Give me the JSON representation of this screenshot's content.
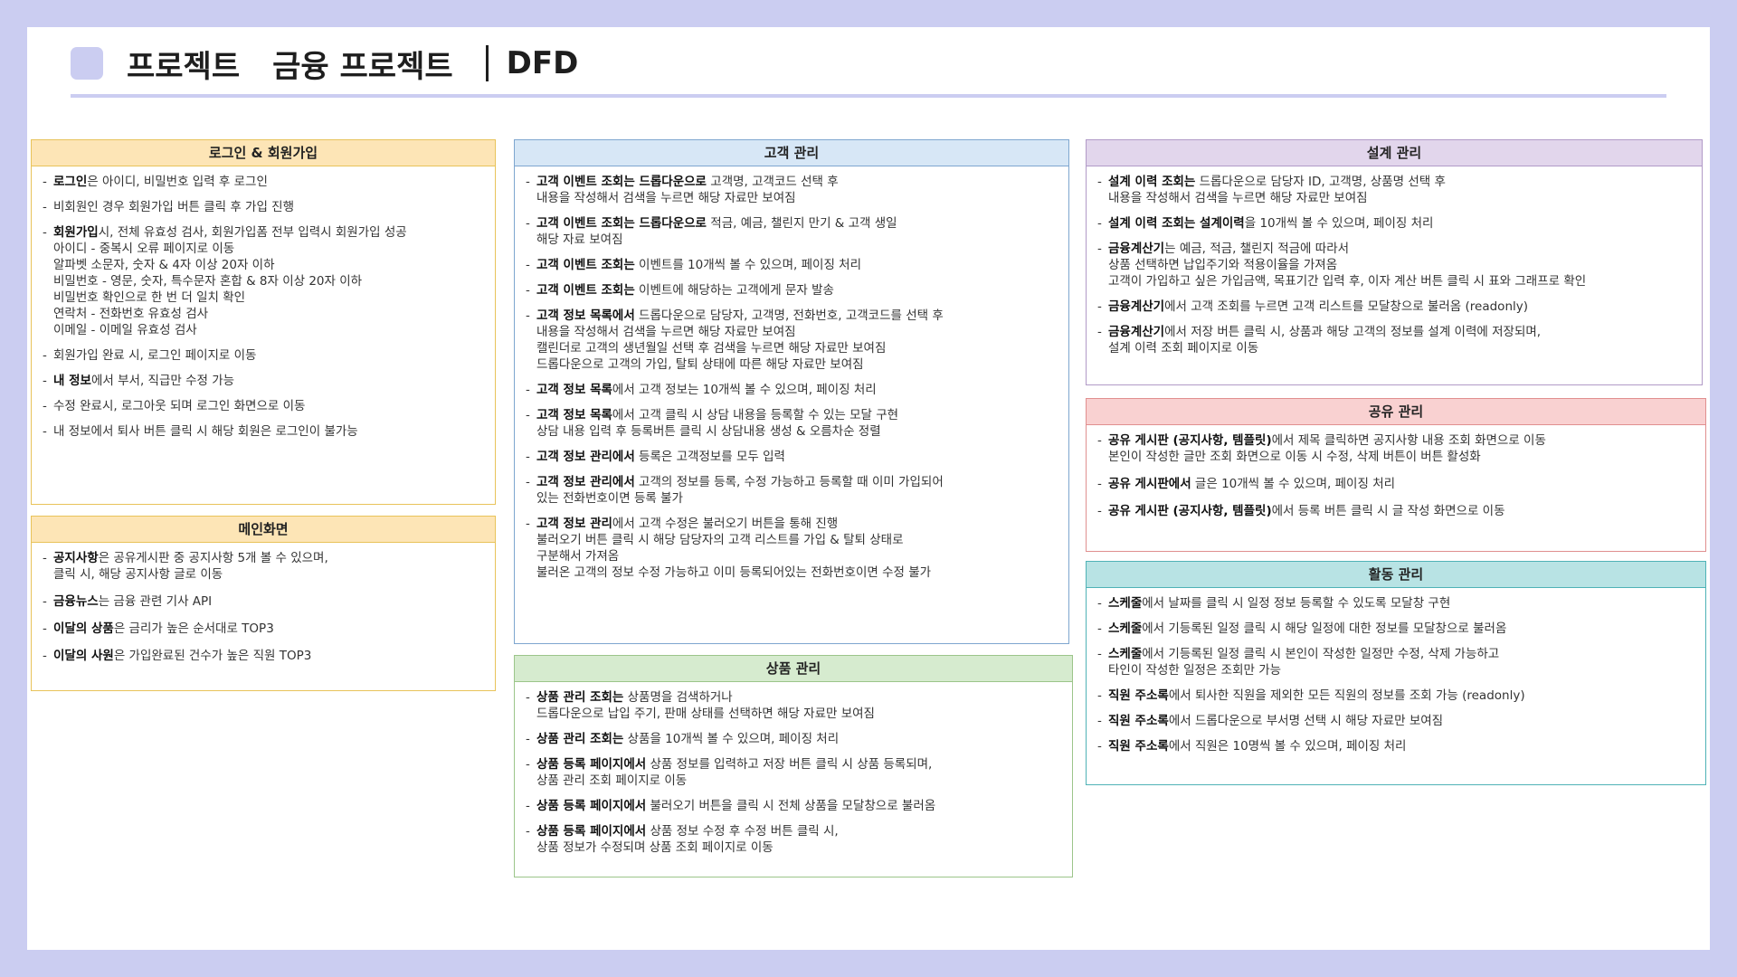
{
  "header": {
    "word1": "프로젝트",
    "word2": "금융 프로젝트",
    "word3": "DFD"
  },
  "panels": {
    "login": {
      "title": "로그인 & 회원가입",
      "items": [
        {
          "b": "로그인",
          "t": "은 아이디, 비밀번호 입력 후 로그인"
        },
        {
          "b": "",
          "t": "비회원인 경우 회원가입 버튼 클릭 후 가입 진행"
        },
        {
          "b": "회원가입",
          "t": "시, 전체 유효성 검사, 회원가입폼 전부 입력시 회원가입 성공\n아이디 - 중복시 오류 페이지로 이동\n        알파벳 소문자, 숫자 & 4자 이상 20자 이하\n비밀번호 - 영문, 숫자, 특수문자 혼합 & 8자 이상 20자 이하\n           비밀번호 확인으로 한 번 더 일치 확인\n연락처 - 전화번호 유효성 검사\n이메일 - 이메일 유효성 검사"
        },
        {
          "b": "",
          "t": "회원가입 완료 시, 로그인 페이지로 이동"
        },
        {
          "b": "내 정보",
          "t": "에서 부서, 직급만 수정 가능"
        },
        {
          "b": "",
          "t": "수정 완료시, 로그아웃 되며 로그인 화면으로 이동"
        },
        {
          "b": "",
          "t": "내 정보에서 퇴사 버튼 클릭 시 해당 회원은 로그인이 불가능"
        }
      ]
    },
    "main": {
      "title": "메인화면",
      "items": [
        {
          "b": "공지사항",
          "t": "은 공유게시판 중 공지사항 5개 볼 수 있으며,\n클릭 시, 해당 공지사항 글로 이동"
        },
        {
          "b": "금융뉴스",
          "t": "는 금융 관련 기사 API"
        },
        {
          "b": "이달의 상품",
          "t": "은 금리가 높은 순서대로 TOP3"
        },
        {
          "b": "이달의 사원",
          "t": "은 가입완료된 건수가 높은 직원 TOP3"
        }
      ]
    },
    "customer": {
      "title": "고객 관리",
      "items": [
        {
          "b": "고객 이벤트 조회는 드롭다운으로",
          "t": " 고객명, 고객코드 선택 후\n내용을 작성해서 검색을 누르면 해당 자료만 보여짐"
        },
        {
          "b": "고객 이벤트 조회는 드롭다운으로",
          "t": " 적금, 예금, 챌린지 만기 & 고객 생일\n해당 자료 보여짐"
        },
        {
          "b": "고객 이벤트 조회는",
          "t": " 이벤트를 10개씩 볼 수 있으며, 페이징 처리"
        },
        {
          "b": "고객 이벤트 조회는",
          "t": " 이벤트에 해당하는 고객에게 문자 발송"
        },
        {
          "b": "고객 정보 목록에서",
          "t": " 드롭다운으로 담당자, 고객명, 전화번호, 고객코드를 선택 후\n내용을 작성해서 검색을 누르면 해당 자료만 보여짐\n캘린더로 고객의 생년월일 선택 후 검색을 누르면 해당 자료만 보여짐\n드롭다운으로 고객의 가입, 탈퇴 상태에 따른 해당 자료만 보여짐"
        },
        {
          "b": "고객 정보 목록",
          "t": "에서 고객 정보는 10개씩 볼 수 있으며, 페이징 처리"
        },
        {
          "b": "고객 정보 목록",
          "t": "에서 고객 클릭 시 상담 내용을 등록할 수 있는 모달 구현\n상담 내용 입력 후 등록버튼 클릭 시 상담내용 생성 & 오름차순 정렬"
        },
        {
          "b": "고객 정보 관리에서",
          "t": " 등록은 고객정보를 모두 입력"
        },
        {
          "b": "고객 정보 관리에서",
          "t": " 고객의 정보를 등록, 수정 가능하고 등록할 때 이미 가입되어\n있는 전화번호이면 등록 불가"
        },
        {
          "b": "고객 정보 관리",
          "t": "에서 고객 수정은 불러오기 버튼을 통해 진행\n불러오기 버튼 클릭 시 해당 담당자의 고객 리스트를 가입 & 탈퇴 상태로\n구분해서 가져옴\n불러온 고객의 정보 수정 가능하고 이미 등록되어있는 전화번호이면 수정 불가"
        }
      ]
    },
    "product": {
      "title": "상품 관리",
      "items": [
        {
          "b": "상품 관리 조회는",
          "t": " 상품명을 검색하거나\n드롭다운으로 납입 주기, 판매 상태를 선택하면 해당 자료만 보여짐"
        },
        {
          "b": "상품 관리 조회는",
          "t": " 상품을 10개씩 볼 수 있으며, 페이징 처리"
        },
        {
          "b": "상품 등록 페이지에서",
          "t": " 상품 정보를 입력하고 저장 버튼 클릭 시 상품 등록되며,\n상품 관리 조회 페이지로 이동"
        },
        {
          "b": "상품 등록 페이지에서",
          "t": " 불러오기 버튼을 클릭 시 전체 상품을 모달창으로 불러옴"
        },
        {
          "b": "상품 등록 페이지에서",
          "t": " 상품 정보 수정 후 수정 버튼 클릭 시,\n상품 정보가 수정되며 상품 조회 페이지로 이동"
        }
      ]
    },
    "design": {
      "title": "설계 관리",
      "items": [
        {
          "b": "설계 이력 조회는",
          "t": " 드롭다운으로 담당자 ID, 고객명, 상품명 선택 후\n내용을 작성해서 검색을 누르면 해당 자료만 보여짐"
        },
        {
          "b": "설계 이력 조회는 설계이력",
          "t": "을 10개씩 볼 수 있으며, 페이징 처리"
        },
        {
          "b": "금융계산기",
          "t": "는 예금, 적금, 챌린지 적금에 따라서\n상품 선택하면 납입주기와 적용이율을 가져옴\n고객이 가입하고 싶은 가입금액, 목표기간 입력 후, 이자 계산 버튼 클릭 시 표와 그래프로 확인"
        },
        {
          "b": "금융계산기",
          "t": "에서 고객 조회를 누르면 고객 리스트를 모달창으로 불러옴 (readonly)"
        },
        {
          "b": "금융계산기",
          "t": "에서 저장 버튼 클릭 시, 상품과 해당 고객의 정보를 설계 이력에 저장되며,\n설계 이력 조회 페이지로 이동"
        }
      ]
    },
    "share": {
      "title": "공유 관리",
      "items": [
        {
          "b": "공유 게시판 (공지사항, 템플릿)",
          "t": "에서 제목 클릭하면 공지사항 내용 조회 화면으로 이동\n본인이 작성한 글만 조회 화면으로 이동 시 수정, 삭제 버튼이 버튼 활성화"
        },
        {
          "b": "공유 게시판에서",
          "t": " 글은 10개씩 볼 수 있으며, 페이징 처리"
        },
        {
          "b": "공유 게시판 (공지사항, 템플릿)",
          "t": "에서 등록 버튼 클릭 시 글 작성 화면으로 이동"
        }
      ]
    },
    "activity": {
      "title": "활동 관리",
      "items": [
        {
          "b": "스케줄",
          "t": "에서 날짜를 클릭 시 일정 정보 등록할 수 있도록 모달창 구현"
        },
        {
          "b": "스케줄",
          "t": "에서 기등록된 일정 클릭 시 해당 일정에 대한 정보를 모달창으로 불러옴"
        },
        {
          "b": "스케줄",
          "t": "에서 기등록된 일정 클릭 시 본인이 작성한 일정만 수정, 삭제 가능하고\n타인이 작성한 일정은 조회만 가능"
        },
        {
          "b": "직원 주소록",
          "t": "에서 퇴사한 직원을 제외한 모든 직원의 정보를 조회 가능 (readonly)"
        },
        {
          "b": "직원 주소록",
          "t": "에서 드롭다운으로 부서명 선택 시 해당 자료만 보여짐"
        },
        {
          "b": "직원 주소록",
          "t": "에서 직원은 10명씩 볼 수 있으며, 페이징 처리"
        }
      ]
    }
  }
}
